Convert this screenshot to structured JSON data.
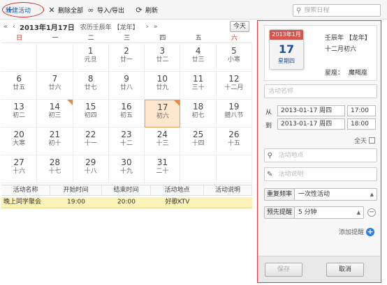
{
  "toolbar": {
    "new_label": "新建活动",
    "delete_label": "删除全部",
    "import_label": "导入/导出",
    "refresh_label": "刷新",
    "search_placeholder": "搜索日程"
  },
  "nav": {
    "month": "2013年1月17日",
    "lunar": "农历壬辰年 【龙年】",
    "today_label": "今天"
  },
  "weekdays": [
    "日",
    "一",
    "二",
    "三",
    "四",
    "五",
    "六"
  ],
  "days": [
    {
      "d": "",
      "l": ""
    },
    {
      "d": "",
      "l": ""
    },
    {
      "d": "1",
      "l": "元旦"
    },
    {
      "d": "2",
      "l": "廿一"
    },
    {
      "d": "3",
      "l": "廿二"
    },
    {
      "d": "4",
      "l": "廿三"
    },
    {
      "d": "5",
      "l": "小寒"
    },
    {
      "d": "6",
      "l": "廿五"
    },
    {
      "d": "7",
      "l": "廿六"
    },
    {
      "d": "8",
      "l": "廿七"
    },
    {
      "d": "9",
      "l": "廿八"
    },
    {
      "d": "10",
      "l": "廿九"
    },
    {
      "d": "11",
      "l": "三十"
    },
    {
      "d": "12",
      "l": "十二月"
    },
    {
      "d": "13",
      "l": "初二"
    },
    {
      "d": "14",
      "l": "初三"
    },
    {
      "d": "15",
      "l": "初四"
    },
    {
      "d": "16",
      "l": "初五"
    },
    {
      "d": "17",
      "l": "初六"
    },
    {
      "d": "18",
      "l": "初七"
    },
    {
      "d": "19",
      "l": "腊八节"
    },
    {
      "d": "20",
      "l": "大寒"
    },
    {
      "d": "21",
      "l": "初十"
    },
    {
      "d": "22",
      "l": "十一"
    },
    {
      "d": "23",
      "l": "十二"
    },
    {
      "d": "24",
      "l": "十三"
    },
    {
      "d": "25",
      "l": "十四"
    },
    {
      "d": "26",
      "l": "十五"
    },
    {
      "d": "27",
      "l": "十六"
    },
    {
      "d": "28",
      "l": "十七"
    },
    {
      "d": "29",
      "l": "十八"
    },
    {
      "d": "30",
      "l": "十九"
    },
    {
      "d": "31",
      "l": "二十"
    },
    {
      "d": "",
      "l": ""
    },
    {
      "d": "",
      "l": ""
    }
  ],
  "event_table": {
    "headers": [
      "活动名称",
      "开始时间",
      "结束时间",
      "活动地点",
      "活动说明"
    ],
    "rows": [
      [
        "晚上同学聚会",
        "19:00",
        "20:00",
        "好歌KTV",
        ""
      ]
    ]
  },
  "panel": {
    "icon_month": "2013年1月",
    "icon_day": "17",
    "icon_weekday": "星期四",
    "lunar_year": "壬辰年 【龙年】",
    "lunar_date": "十二月初六",
    "constellation_label": "星座：",
    "constellation": "魔羯座",
    "name_placeholder": "活动名称",
    "from_label": "从",
    "to_label": "到",
    "from_date": "2013-01-17 周四",
    "from_time": "17:00",
    "to_date": "2013-01-17 周四",
    "to_time": "18:00",
    "allday_label": "全天",
    "location_placeholder": "活动地点",
    "desc_placeholder": "活动说明",
    "repeat_label": "重复频率",
    "repeat_value": "一次性活动",
    "remind_label": "预先提醒",
    "remind_value": "5 分钟",
    "add_remind_label": "添加提醒",
    "save_label": "保存",
    "cancel_label": "取消"
  }
}
